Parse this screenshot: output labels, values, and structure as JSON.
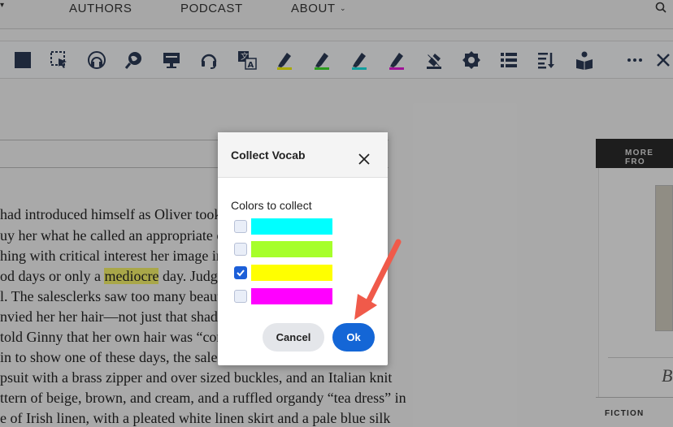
{
  "nav": {
    "items": [
      {
        "label": "AUTHORS",
        "has_chevron": false
      },
      {
        "label": "PODCAST",
        "has_chevron": false
      },
      {
        "label": "ABOUT",
        "has_chevron": true
      }
    ]
  },
  "toolbar": {
    "icons": [
      "stop-square-icon",
      "selection-cursor-icon",
      "audio-headphones-icon",
      "globe-search-icon",
      "screen-icon",
      "headset-icon",
      "translate-icon",
      "highlighter-yellow-icon",
      "highlighter-green-icon",
      "highlighter-cyan-icon",
      "highlighter-magenta-icon",
      "eraser-icon",
      "settings-badge-icon",
      "list-icon",
      "sort-icon",
      "vocab-book-icon",
      "more-icon"
    ]
  },
  "article": {
    "lines": [
      "had introduced himself as Oliver took G",
      "uy her what he called an appropriate ou",
      "hing with critical interest her image in",
      "od days or only a ",
      "l. The salesclerks saw too many beautif",
      "nvied her her hair—not just that shade",
      " told Ginny that her own hair was “com",
      "in to show one of these days, the salesg",
      "psuit with a brass zipper and over sized buckles, and an Italian knit",
      "ttern of beige, brown, and cream, and a ruffled organdy “tea dress” in",
      "e of Irish linen, with a pleated white linen skirt and a pale blue silk"
    ],
    "highlight_word": "mediocre",
    "line4_suffix": " day. Judging"
  },
  "sidebar": {
    "header": "MORE FRO",
    "italic_letter": "B",
    "section": "FICTION"
  },
  "dialog": {
    "title": "Collect Vocab",
    "subtitle": "Colors to collect",
    "colors": [
      {
        "hex": "#00ffff",
        "checked": false
      },
      {
        "hex": "#a6ff2b",
        "checked": false
      },
      {
        "hex": "#ffff00",
        "checked": true
      },
      {
        "hex": "#ff00ff",
        "checked": false
      }
    ],
    "cancel_label": "Cancel",
    "ok_label": "Ok"
  },
  "colors": {
    "accent": "#1466d6",
    "annotation_arrow": "#f05a4a"
  }
}
